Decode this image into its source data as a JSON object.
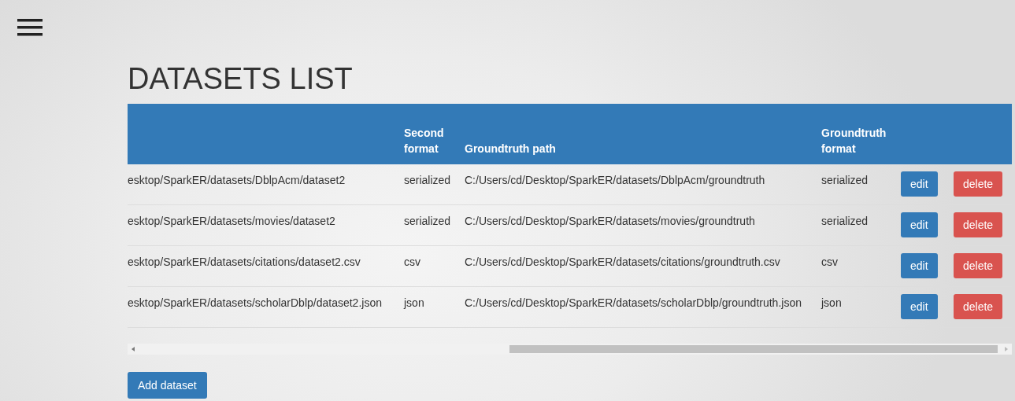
{
  "title": "DATASETS LIST",
  "table": {
    "columns": [
      "Second format",
      "Groundtruth path",
      "Groundtruth format"
    ],
    "rows": [
      {
        "column_1": "esktop/SparkER/datasets/DblpAcm/dataset2",
        "second_format": "serialized",
        "groundtruth_path": "C:/Users/cd/Desktop/SparkER/datasets/DblpAcm/groundtruth",
        "groundtruth_format": "serialized",
        "actions": [
          {
            "label": "edit",
            "kind": "primary"
          },
          {
            "label": "delete",
            "kind": "danger"
          }
        ]
      },
      {
        "column_1": "esktop/SparkER/datasets/movies/dataset2",
        "second_format": "serialized",
        "groundtruth_path": "C:/Users/cd/Desktop/SparkER/datasets/movies/groundtruth",
        "groundtruth_format": "serialized",
        "actions": [
          {
            "label": "edit",
            "kind": "primary"
          },
          {
            "label": "delete",
            "kind": "danger"
          }
        ]
      },
      {
        "column_1": "esktop/SparkER/datasets/citations/dataset2.csv",
        "second_format": "csv",
        "groundtruth_path": "C:/Users/cd/Desktop/SparkER/datasets/citations/groundtruth.csv",
        "groundtruth_format": "csv",
        "actions": [
          {
            "label": "edit",
            "kind": "primary"
          },
          {
            "label": "delete",
            "kind": "danger"
          }
        ]
      },
      {
        "column_1": "esktop/SparkER/datasets/scholarDblp/dataset2.json",
        "second_format": "json",
        "groundtruth_path": "C:/Users/cd/Desktop/SparkER/datasets/scholarDblp/groundtruth.json",
        "groundtruth_format": "json",
        "actions": [
          {
            "label": "edit",
            "kind": "primary"
          },
          {
            "label": "delete",
            "kind": "danger"
          }
        ]
      }
    ]
  },
  "add_button": "Add dataset"
}
